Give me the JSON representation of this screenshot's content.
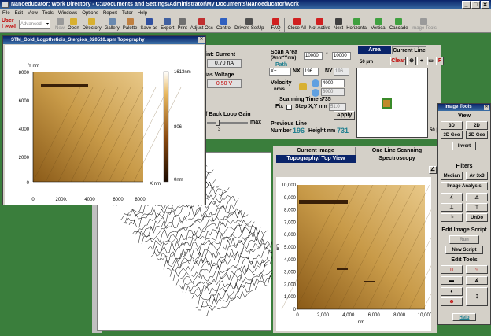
{
  "app": {
    "title": "Nanoeducator; Work Directory - C:\\Documents and Settings\\Administrator\\My Documents\\Nanoeducator\\work",
    "window_buttons": [
      "_",
      "□",
      "✕"
    ]
  },
  "menu": [
    "File",
    "Edit",
    "View",
    "Tools",
    "Windows",
    "Options",
    "Report",
    "Tutor",
    "Help"
  ],
  "toolbar": {
    "user_level_label": "User Level",
    "user_level_value": "Advanced",
    "buttons": [
      {
        "label": "New",
        "icon": "new-doc-icon",
        "color": "#9a9a9a",
        "enabled": false
      },
      {
        "label": "Open",
        "icon": "folder-icon",
        "color": "#d8b030",
        "enabled": true
      },
      {
        "label": "Directory",
        "icon": "directory-icon",
        "color": "#d8b030",
        "enabled": true
      },
      {
        "label": "Gallery",
        "icon": "gallery-icon",
        "color": "#6a8ab0",
        "enabled": true
      },
      {
        "label": "Palette",
        "icon": "palette-icon",
        "color": "#c08040",
        "enabled": true
      },
      {
        "label": "Save as",
        "icon": "save-icon",
        "color": "#3050a0",
        "enabled": true
      },
      {
        "label": "Export",
        "icon": "export-icon",
        "color": "#4060a0",
        "enabled": true
      },
      {
        "label": "Print",
        "icon": "printer-icon",
        "color": "#707070",
        "enabled": true
      },
      {
        "label": "Adjust Osc",
        "icon": "oscillator-icon",
        "color": "#c03030",
        "enabled": true
      },
      {
        "label": "Control",
        "icon": "control-icon",
        "color": "#3060c0",
        "enabled": true
      },
      {
        "label": "Drivers SetUp",
        "icon": "drivers-icon",
        "color": "#505050",
        "enabled": true
      },
      {
        "label": "FAQ",
        "icon": "faq-icon",
        "color": "#d02020",
        "enabled": true
      },
      {
        "label": "Close All",
        "icon": "close-all-icon",
        "color": "#d02020",
        "enabled": true
      },
      {
        "label": "Not Active",
        "icon": "not-active-icon",
        "color": "#d02020",
        "enabled": true
      },
      {
        "label": "Next",
        "icon": "next-icon",
        "color": "#404040",
        "enabled": true
      },
      {
        "label": "Horizontal",
        "icon": "tile-horizontal-icon",
        "color": "#40a040",
        "enabled": true
      },
      {
        "label": "Vertical",
        "icon": "tile-vertical-icon",
        "color": "#40a040",
        "enabled": true
      },
      {
        "label": "Cascade",
        "icon": "cascade-icon",
        "color": "#40a040",
        "enabled": true
      },
      {
        "label": "Image Tools",
        "icon": "image-tools-icon",
        "color": "#9a9a9a",
        "enabled": false
      }
    ]
  },
  "main_panel": {
    "setpoint_label": "int: Current",
    "setpoint_value": "0.70 nA",
    "bias_label": "ias Voltage",
    "bias_value": "0.50 V",
    "gain_label": "f Back Loop Gain",
    "gain_max": "max",
    "gain_value": "3",
    "scan_area_label": "Scan Area",
    "scan_area_unit": "(Xnm*Ynm)",
    "scan_x": "10000",
    "scan_times": "*",
    "scan_y": "10000",
    "path_label": "Path",
    "path_value": "X+",
    "nx_label": "NX",
    "nx_value": "196",
    "ny_label": "NY",
    "ny_value": "196",
    "velocity_label": "Velocity",
    "velocity_unit": "nm/s",
    "velocity_value": "4000",
    "velocity_value2": "8000",
    "scan_time_label": "Scanning Time s",
    "scan_time_value": "735",
    "fix_label": "Fix",
    "step_label": "Step X,Y nm",
    "step_value": "51.0",
    "apply_label": "Apply",
    "prev_line_label": "Previous  Line",
    "number_label": "Number",
    "number_value": "196",
    "height_label": "Height nm",
    "height_value": "731",
    "area_tab": "Area",
    "current_line_tab": "Current Line",
    "clear_label": "Clear",
    "f_label": "F",
    "scale_left": "50 µm",
    "scale_right": "50 |"
  },
  "topo_window": {
    "title": "STM_Gold_Logothetidis_Stergios_020510.spm  Topography",
    "y_label": "Y nm",
    "x_label": "X nm",
    "y_ticks": [
      "8000",
      "6000",
      "4000",
      "2000",
      "0"
    ],
    "x_ticks": [
      "0",
      "2000.",
      "4000",
      "6000",
      "8000"
    ],
    "cbar_max": "1613nm",
    "cbar_mid": "806",
    "cbar_min": "0nm"
  },
  "right_panel": {
    "tab_current_image": "Current Image",
    "tab_one_line": "One Line Scanning",
    "tab_topography": "Topography/ Top View",
    "tab_spectroscopy": "Spectroscopy",
    "y_axis_label": "nm",
    "x_axis_label": "nm",
    "y_ticks": [
      "10,000",
      "9,000",
      "8,000",
      "7,000",
      "6,000",
      "5,000",
      "4,000",
      "3,000",
      "2,000",
      "1,000",
      "0"
    ],
    "x_ticks": [
      "0",
      "2,000",
      "4,000",
      "6,000",
      "8,000",
      "10,000"
    ]
  },
  "image_tools": {
    "title": "Image Tools",
    "view": "View",
    "btn_3d": "3D",
    "btn_2d": "2D",
    "btn_3dgeo": "3D Geo",
    "btn_2dgeo": "2D Geo",
    "invert": "Invert",
    "filters": "Filters",
    "median": "Median",
    "av3x3": "Av 3x3",
    "image_analysis": "Image Analysis",
    "undo": "UnDo",
    "edit_script": "Edit Image Script",
    "run": "Run",
    "new_script": "New Script",
    "edit_tools": "Edit Tools",
    "help": "Help"
  }
}
